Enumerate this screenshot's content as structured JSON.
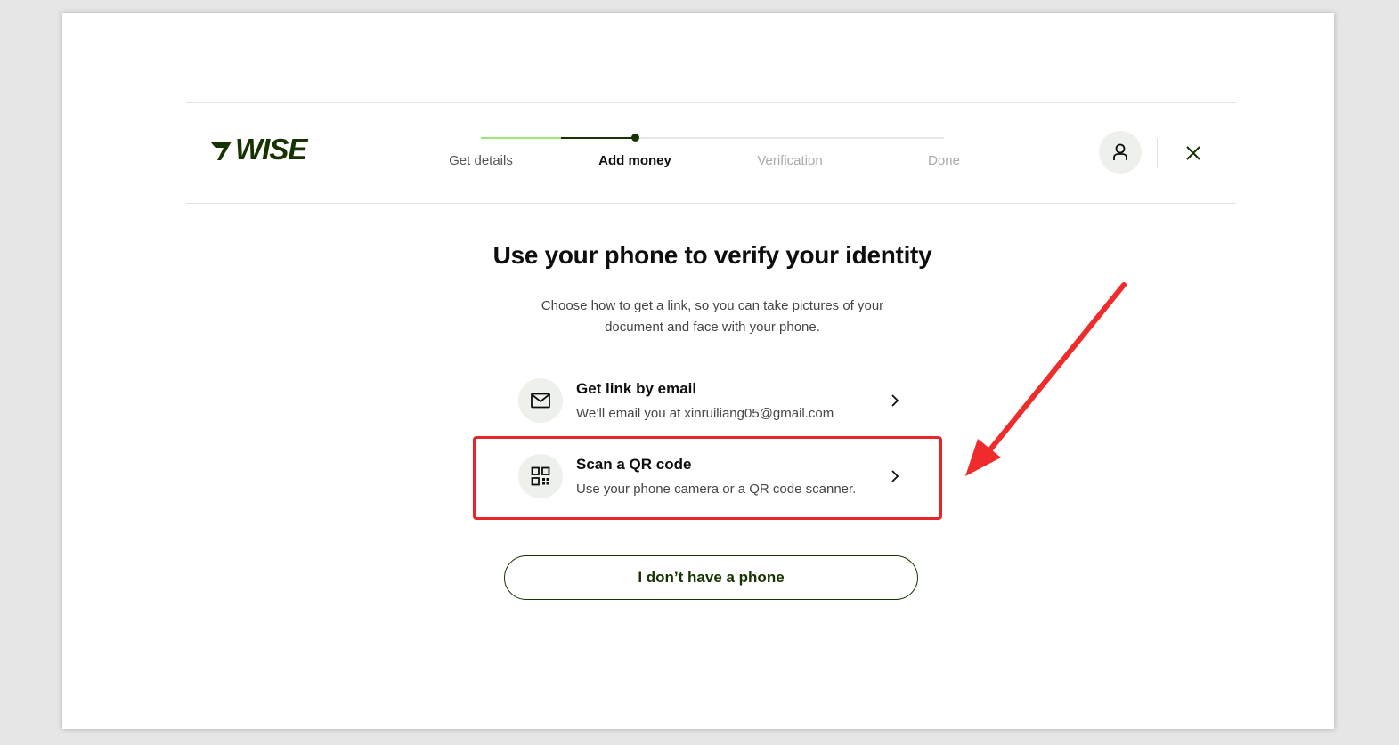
{
  "brand": {
    "logo_text": "WISE",
    "brand_color": "#163300",
    "accent_color": "#9fe870"
  },
  "stepper": {
    "steps": [
      {
        "label": "Get details",
        "state": "done"
      },
      {
        "label": "Add money",
        "state": "active"
      },
      {
        "label": "Verification",
        "state": "upcoming"
      },
      {
        "label": "Done",
        "state": "upcoming"
      }
    ]
  },
  "header": {
    "avatar_icon": "user-icon",
    "close_icon": "close-icon"
  },
  "main": {
    "title": "Use your phone to verify your identity",
    "subtitle_line1": "Choose how to get a link, so you can take pictures of your",
    "subtitle_line2": "document and face with your phone.",
    "options": [
      {
        "title": "Get link by email",
        "description": "We’ll email you at xinruiliang05@gmail.com",
        "icon": "mail-icon"
      },
      {
        "title": "Scan a QR code",
        "description": "Use your phone camera or a QR code scanner.",
        "icon": "qr-code-icon"
      }
    ],
    "no_phone_button": "I don’t have a phone"
  },
  "annotation": {
    "highlight_color": "#e8262a",
    "arrow_color": "#ef2b2b"
  }
}
